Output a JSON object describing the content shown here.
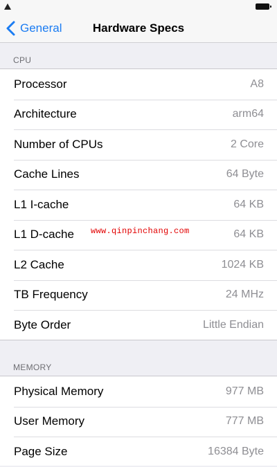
{
  "nav": {
    "back_label": "General",
    "title": "Hardware Specs"
  },
  "sections": {
    "cpu": {
      "header": "CPU",
      "rows": [
        {
          "label": "Processor",
          "value": "A8"
        },
        {
          "label": "Architecture",
          "value": "arm64"
        },
        {
          "label": "Number of CPUs",
          "value": "2 Core"
        },
        {
          "label": "Cache Lines",
          "value": "64 Byte"
        },
        {
          "label": "L1 I-cache",
          "value": "64 KB"
        },
        {
          "label": "L1 D-cache",
          "value": "64 KB"
        },
        {
          "label": "L2 Cache",
          "value": "1024 KB"
        },
        {
          "label": "TB Frequency",
          "value": "24 MHz"
        },
        {
          "label": "Byte Order",
          "value": "Little Endian"
        }
      ]
    },
    "memory": {
      "header": "MEMORY",
      "rows": [
        {
          "label": "Physical Memory",
          "value": "977 MB"
        },
        {
          "label": "User Memory",
          "value": "777 MB"
        },
        {
          "label": "Page Size",
          "value": "16384 Byte"
        }
      ]
    }
  },
  "watermark": "www.qinpinchang.com",
  "icons": {
    "back": "chevron-left-icon",
    "signal": "signal-icon",
    "battery": "battery-icon"
  },
  "colors": {
    "accent": "#1b7cf2",
    "background": "#efeff4",
    "value_text": "#8e8e93",
    "watermark": "#e20000"
  }
}
